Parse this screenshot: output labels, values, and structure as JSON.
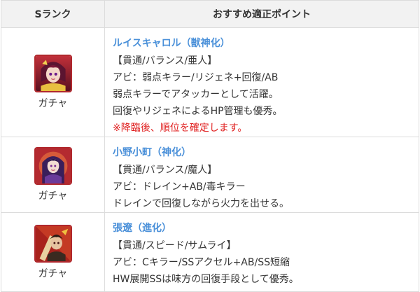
{
  "header": {
    "rank": "Sランク",
    "points": "おすすめ適正ポイント"
  },
  "rows": [
    {
      "source": "ガチャ",
      "name": "ルイスキャロル（獣神化）",
      "lines": [
        "【貫通/バランス/亜人】",
        "アビ：弱点キラー/リジェネ+回復/AB",
        "弱点キラーでアタッカーとして活躍。",
        "回復やリジェネによるHP管理も優秀。"
      ],
      "note": "※降臨後、順位を確定します。"
    },
    {
      "source": "ガチャ",
      "name": "小野小町（神化）",
      "lines": [
        "【貫通/バランス/魔人】",
        "アビ：ドレイン+AB/毒キラー",
        "ドレインで回復しながら火力を出せる。"
      ]
    },
    {
      "source": "ガチャ",
      "name": "張遼（進化）",
      "lines": [
        "【貫通/スピード/サムライ】",
        "アビ：Cキラー/SSアクセル+AB/SS短縮",
        "HW展開SSは味方の回復手段として優秀。"
      ]
    }
  ],
  "colors": {
    "name": "#4a90d9",
    "note": "#e02020",
    "header_bg": "#f2f2f2",
    "border": "#dcdcdc"
  }
}
